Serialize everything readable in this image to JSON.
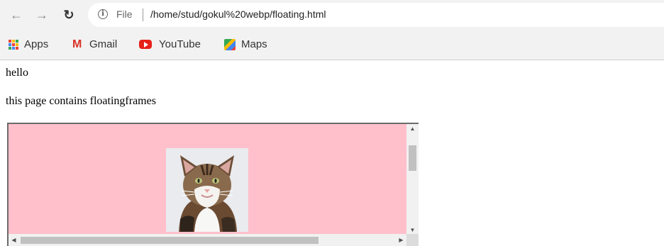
{
  "toolbar": {
    "back_icon": "arrow-left-icon",
    "forward_icon": "arrow-right-icon",
    "reload_icon": "reload-icon",
    "scheme_label": "File",
    "url": "/home/stud/gokul%20webp/floating.html"
  },
  "bookmarks": [
    {
      "label": "Apps",
      "icon": "apps-grid-icon"
    },
    {
      "label": "Gmail",
      "icon": "gmail-icon"
    },
    {
      "label": "YouTube",
      "icon": "youtube-icon"
    },
    {
      "label": "Maps",
      "icon": "maps-icon"
    }
  ],
  "page": {
    "line1": "hello",
    "line2": "this page contains floatingframes"
  },
  "iframe": {
    "background": "#ffc0cb",
    "image": "cat-image"
  },
  "colors": {
    "toolbar_bg": "#f2f2f2",
    "iframe_bg": "#ffc0cb",
    "youtube_red": "#e62117",
    "gmail_red": "#d93025"
  }
}
